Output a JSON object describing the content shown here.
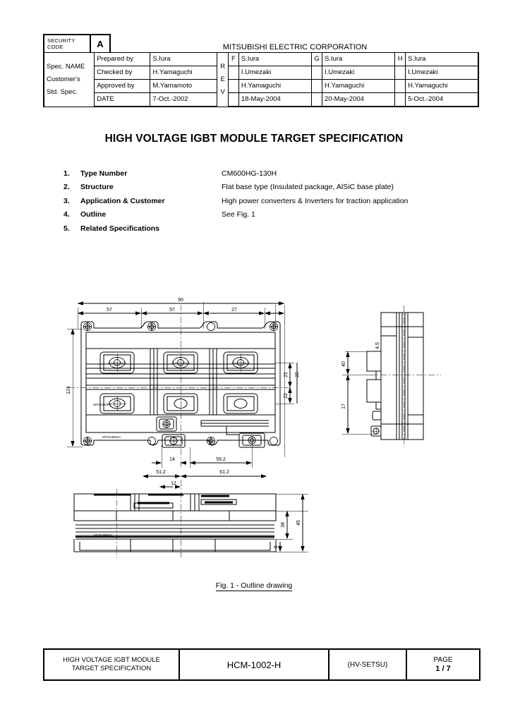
{
  "header": {
    "security_code_label": "SECURITY CODE",
    "security_code_value": "A",
    "corporation": "MITSUBISHI ELECTRIC CORPORATION",
    "spec_name_lines": [
      "Spec. NAME",
      "Customer's",
      "Std. Spec."
    ],
    "role_labels": [
      "Prepared by",
      "Checked by",
      "Approved by",
      "DATE"
    ],
    "rev_label": "REV",
    "base_column": {
      "prepared_by": "S.Iura",
      "checked_by": "H.Yamaguchi",
      "approved_by": "M.Yamamoto",
      "date": "7-Oct.-2002"
    },
    "revisions": [
      {
        "letter": "F",
        "prepared_by": "S.Iura",
        "checked_by": "I.Umezaki",
        "approved_by": "H.Yamaguchi",
        "date": "18-May-2004"
      },
      {
        "letter": "G",
        "prepared_by": "S.Iura",
        "checked_by": "I.Umezaki",
        "approved_by": "H.Yamaguchi",
        "date": "20-May-2004"
      },
      {
        "letter": "H",
        "prepared_by": "S.Iura",
        "checked_by": "I.Umezaki",
        "approved_by": "H.Yamaguchi",
        "date": "5-Oct.-2004"
      }
    ]
  },
  "title": "HIGH VOLTAGE IGBT MODULE TARGET SPECIFICATION",
  "spec_items": [
    {
      "num": "1.",
      "label": "Type Number",
      "value": "CM600HG-130H"
    },
    {
      "num": "2.",
      "label": "Structure",
      "value": "Flat base type (Insulated package, AlSiC base plate)"
    },
    {
      "num": "3.",
      "label": "Application & Customer",
      "value": "High power converters & Inverters for traction application"
    },
    {
      "num": "4.",
      "label": "Outline",
      "value": "See Fig. 1"
    },
    {
      "num": "5.",
      "label": "Related Specifications",
      "value": ""
    }
  ],
  "figure": {
    "caption": "Fig. 1 - Outline drawing",
    "brand_mark": "MITSUBISHI",
    "dimensions": {
      "top_overall": "90",
      "top_left_span": "57",
      "top_mid_span": "57",
      "top_right_span": "27",
      "left_height": "124",
      "right_pitch_upper": "22",
      "right_pitch_lower": "22",
      "bottom_small": "14",
      "bottom_mid": "59.2",
      "bottom_left_ext": "51.2",
      "bottom_right_ext": "61.2",
      "bottom_view_small": "12",
      "side_height_1": "40",
      "side_height_2": "17",
      "side_height_3": "4.5",
      "front_height_main": "38",
      "front_height_overall": "45",
      "front_height_base": "5"
    }
  },
  "footer": {
    "title_line1": "HIGH VOLTAGE IGBT MODULE",
    "title_line2": "TARGET SPECIFICATION",
    "doc_code": "HCM-1002-H",
    "department": "(HV-SETSU)",
    "page_label": "PAGE",
    "page_value": "1 / 7"
  }
}
